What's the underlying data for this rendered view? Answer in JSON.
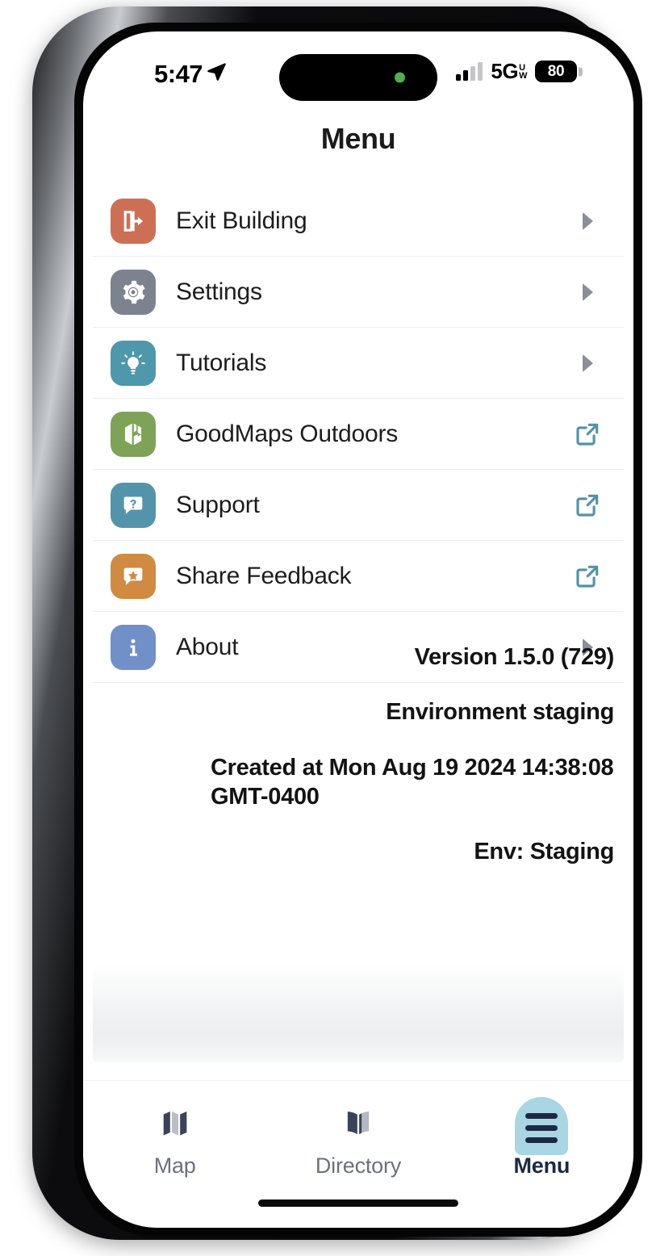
{
  "status_bar": {
    "time": "5:47",
    "location_icon": "location-arrow-icon",
    "network_label": "5G",
    "network_sub_top": "U",
    "network_sub_bottom": "W",
    "battery_level": "80",
    "signal_bars_active": 2,
    "signal_bars_total": 4
  },
  "header": {
    "title": "Menu"
  },
  "menu": {
    "items": [
      {
        "label": "Exit Building",
        "icon": "exit-door-icon",
        "icon_color": "#cd6f55",
        "accessory": "disclosure-triangle-icon"
      },
      {
        "label": "Settings",
        "icon": "gear-icon",
        "icon_color": "#7c838f",
        "accessory": "disclosure-triangle-icon"
      },
      {
        "label": "Tutorials",
        "icon": "lightbulb-icon",
        "icon_color": "#4f97ab",
        "accessory": "disclosure-triangle-icon"
      },
      {
        "label": "GoodMaps Outdoors",
        "icon": "goodmaps-logo-icon",
        "icon_color": "#7ea257",
        "accessory": "external-link-icon"
      },
      {
        "label": "Support",
        "icon": "question-bubble-icon",
        "icon_color": "#5494ab",
        "accessory": "external-link-icon"
      },
      {
        "label": "Share Feedback",
        "icon": "star-bubble-icon",
        "icon_color": "#d08a42",
        "accessory": "external-link-icon"
      },
      {
        "label": "About",
        "icon": "info-icon",
        "icon_color": "#7190c8",
        "accessory": "disclosure-triangle-icon"
      }
    ]
  },
  "build_info": {
    "version": "Version 1.5.0 (729)",
    "environment": "Environment staging",
    "created_at": "Created at Mon Aug 19 2024 14:38:08 GMT-0400",
    "env_short": "Env: Staging"
  },
  "tab_bar": {
    "tabs": [
      {
        "label": "Map",
        "icon": "map-icon",
        "active": false
      },
      {
        "label": "Directory",
        "icon": "book-icon",
        "active": false
      },
      {
        "label": "Menu",
        "icon": "hamburger-icon",
        "active": true
      }
    ]
  },
  "colors": {
    "accent_teal": "#5491a6",
    "active_pill": "#a9d6e2",
    "active_label": "#1b2a44",
    "inactive_label": "#6c717c",
    "separator": "#eceef0"
  }
}
